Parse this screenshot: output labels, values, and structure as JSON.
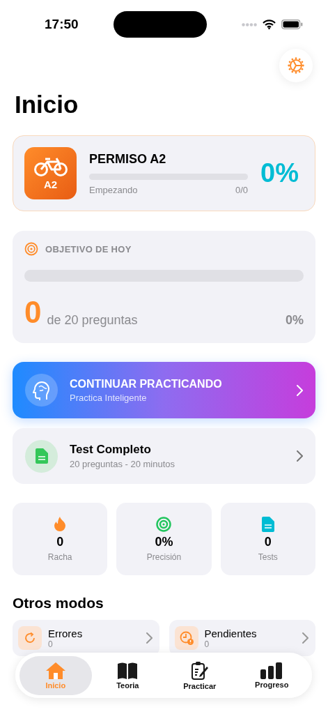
{
  "status_bar": {
    "time": "17:50"
  },
  "title": "Inicio",
  "license": {
    "badge": "A2",
    "name": "PERMISO A2",
    "level": 0,
    "stage": "Empezando",
    "count": "0/0",
    "percent": "0%"
  },
  "goal": {
    "heading": "OBJETIVO DE HOY",
    "level": 0,
    "done": "0",
    "target": "de 20 preguntas",
    "percent": "0%"
  },
  "actions": [
    {
      "kind": "gradient",
      "title": "CONTINUAR PRACTICANDO",
      "subtitle": "Practica Inteligente"
    },
    {
      "kind": "plain",
      "title": "Test Completo",
      "subtitle": "20 preguntas - 20 minutos"
    }
  ],
  "stats": [
    {
      "kind": "flame",
      "value": "0",
      "label": "Racha"
    },
    {
      "kind": "target",
      "value": "0%",
      "label": "Precisión"
    },
    {
      "kind": "document",
      "value": "0",
      "label": "Tests"
    }
  ],
  "modes_heading": "Otros modos",
  "modes": [
    {
      "kind": "retry",
      "title": "Errores",
      "count": "0"
    },
    {
      "kind": "pending",
      "title": "Pendientes",
      "count": "0"
    }
  ],
  "tabs": [
    {
      "kind": "home",
      "label": "Inicio",
      "selected": true
    },
    {
      "kind": "book",
      "label": "Teoria",
      "selected": false
    },
    {
      "kind": "clipboard",
      "label": "Practicar",
      "selected": false
    },
    {
      "kind": "bars",
      "label": "Progreso",
      "selected": false
    }
  ]
}
